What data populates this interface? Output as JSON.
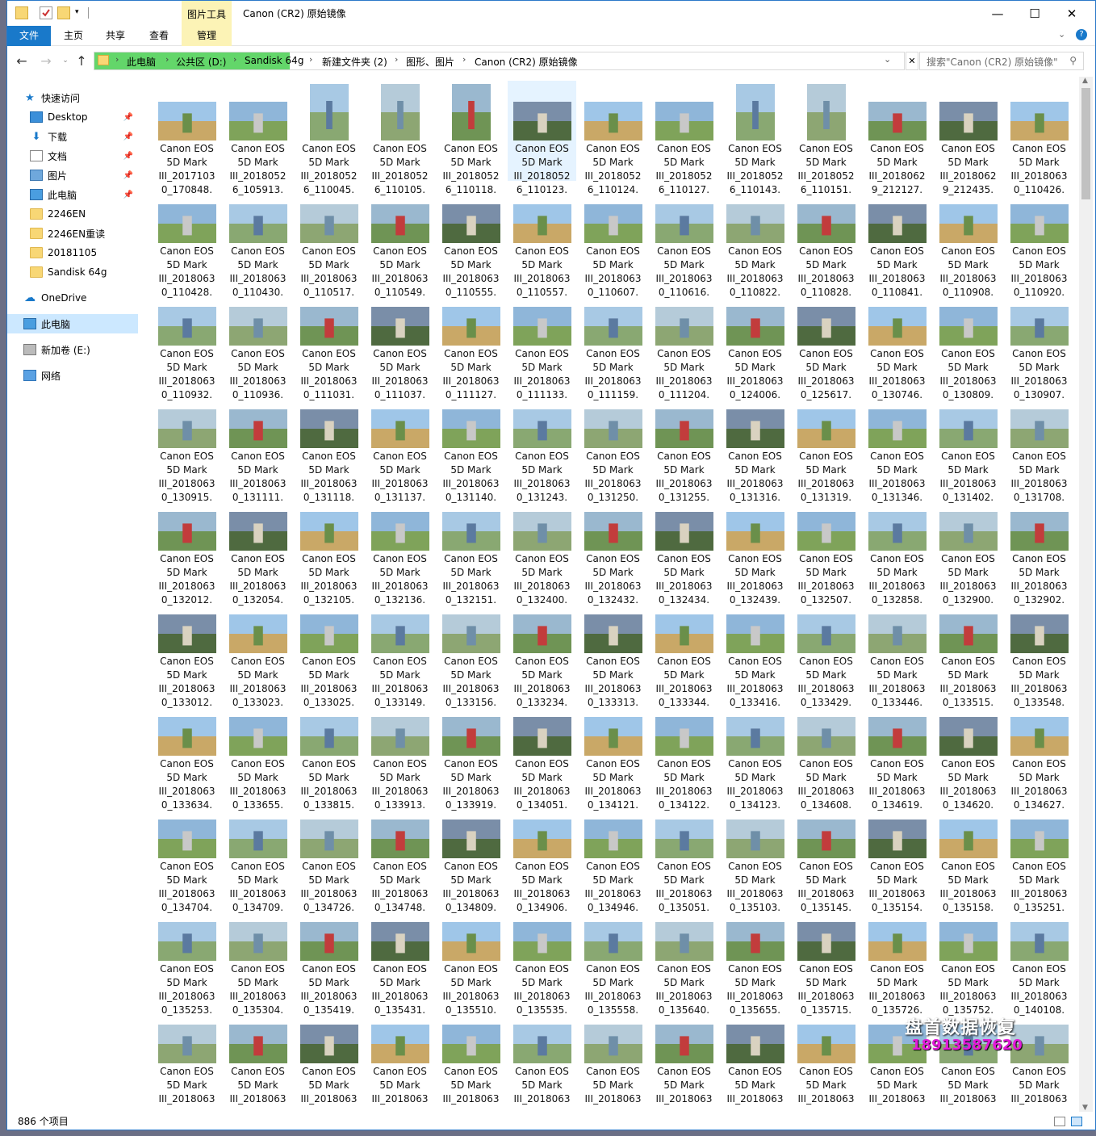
{
  "window": {
    "title": "Canon (CR2) 原始镜像",
    "context_tool": "图片工具",
    "controls": {
      "minimize": "—",
      "maximize": "☐",
      "close": "✕"
    }
  },
  "ribbon": {
    "tabs": [
      {
        "label": "文件",
        "active": true
      },
      {
        "label": "主页"
      },
      {
        "label": "共享"
      },
      {
        "label": "查看"
      },
      {
        "label": "管理"
      }
    ]
  },
  "address": {
    "crumbs": [
      "此电脑",
      "公共区 (D:)",
      "Sandisk 64g",
      "新建文件夹 (2)",
      "图形、图片",
      "Canon (CR2) 原始镜像"
    ],
    "search_placeholder": "搜索\"Canon (CR2) 原始镜像\""
  },
  "nav": {
    "items": [
      {
        "label": "快速访问",
        "icon": "star-icon",
        "pinned": false
      },
      {
        "label": "Desktop",
        "icon": "desktop-icon",
        "pinned": true
      },
      {
        "label": "下载",
        "icon": "download-icon",
        "pinned": true
      },
      {
        "label": "文档",
        "icon": "document-icon",
        "pinned": true
      },
      {
        "label": "图片",
        "icon": "picture-icon",
        "pinned": true
      },
      {
        "label": "此电脑",
        "icon": "computer-icon",
        "pinned": true
      },
      {
        "label": "2246EN",
        "icon": "folder-icon",
        "pinned": false
      },
      {
        "label": "2246EN重读",
        "icon": "folder-icon",
        "pinned": false
      },
      {
        "label": "20181105",
        "icon": "folder-icon",
        "pinned": false
      },
      {
        "label": "Sandisk 64g",
        "icon": "folder-icon",
        "pinned": false
      },
      {
        "label": "OneDrive",
        "icon": "cloud-icon",
        "pinned": false
      },
      {
        "label": "此电脑",
        "icon": "computer-icon",
        "pinned": false,
        "selected": true
      },
      {
        "label": "新加卷 (E:)",
        "icon": "drive-icon",
        "pinned": false
      },
      {
        "label": "网络",
        "icon": "network-icon",
        "pinned": false
      }
    ]
  },
  "files": {
    "line1": "Canon EOS",
    "line2": "5D Mark",
    "rows": [
      [
        "III_2017103|0_170848.",
        "III_2018052|6_105913.",
        "III_2018052|6_110045.",
        "III_2018052|6_110105.",
        "III_2018052|6_110118.",
        "III_2018052|6_110123.",
        "III_2018052|6_110124.",
        "III_2018052|6_110127.",
        "III_2018052|6_110143.",
        "III_2018052|6_110151.",
        "III_2018062|9_212127.",
        "III_2018062|9_212435.",
        "III_2018063|0_110426."
      ],
      [
        "III_2018063|0_110428.",
        "III_2018063|0_110430.",
        "III_2018063|0_110517.",
        "III_2018063|0_110549.",
        "III_2018063|0_110555.",
        "III_2018063|0_110557.",
        "III_2018063|0_110607.",
        "III_2018063|0_110616.",
        "III_2018063|0_110822.",
        "III_2018063|0_110828.",
        "III_2018063|0_110841.",
        "III_2018063|0_110908.",
        "III_2018063|0_110920."
      ],
      [
        "III_2018063|0_110932.",
        "III_2018063|0_110936.",
        "III_2018063|0_111031.",
        "III_2018063|0_111037.",
        "III_2018063|0_111127.",
        "III_2018063|0_111133.",
        "III_2018063|0_111159.",
        "III_2018063|0_111204.",
        "III_2018063|0_124006.",
        "III_2018063|0_125617.",
        "III_2018063|0_130746.",
        "III_2018063|0_130809.",
        "III_2018063|0_130907."
      ],
      [
        "III_2018063|0_130915.",
        "III_2018063|0_131111.",
        "III_2018063|0_131118.",
        "III_2018063|0_131137.",
        "III_2018063|0_131140.",
        "III_2018063|0_131243.",
        "III_2018063|0_131250.",
        "III_2018063|0_131255.",
        "III_2018063|0_131316.",
        "III_2018063|0_131319.",
        "III_2018063|0_131346.",
        "III_2018063|0_131402.",
        "III_2018063|0_131708."
      ],
      [
        "III_2018063|0_132012.",
        "III_2018063|0_132054.",
        "III_2018063|0_132105.",
        "III_2018063|0_132136.",
        "III_2018063|0_132151.",
        "III_2018063|0_132400.",
        "III_2018063|0_132432.",
        "III_2018063|0_132434.",
        "III_2018063|0_132439.",
        "III_2018063|0_132507.",
        "III_2018063|0_132858.",
        "III_2018063|0_132900.",
        "III_2018063|0_132902."
      ],
      [
        "III_2018063|0_133012.",
        "III_2018063|0_133023.",
        "III_2018063|0_133025.",
        "III_2018063|0_133149.",
        "III_2018063|0_133156.",
        "III_2018063|0_133234.",
        "III_2018063|0_133313.",
        "III_2018063|0_133344.",
        "III_2018063|0_133416.",
        "III_2018063|0_133429.",
        "III_2018063|0_133446.",
        "III_2018063|0_133515.",
        "III_2018063|0_133548."
      ],
      [
        "III_2018063|0_133634.",
        "III_2018063|0_133655.",
        "III_2018063|0_133815.",
        "III_2018063|0_133913.",
        "III_2018063|0_133919.",
        "III_2018063|0_134051.",
        "III_2018063|0_134121.",
        "III_2018063|0_134122.",
        "III_2018063|0_134123.",
        "III_2018063|0_134608.",
        "III_2018063|0_134619.",
        "III_2018063|0_134620.",
        "III_2018063|0_134627."
      ],
      [
        "III_2018063|0_134704.",
        "III_2018063|0_134709.",
        "III_2018063|0_134726.",
        "III_2018063|0_134748.",
        "III_2018063|0_134809.",
        "III_2018063|0_134906.",
        "III_2018063|0_134946.",
        "III_2018063|0_135051.",
        "III_2018063|0_135103.",
        "III_2018063|0_135145.",
        "III_2018063|0_135154.",
        "III_2018063|0_135158.",
        "III_2018063|0_135251."
      ],
      [
        "III_2018063|0_135253.",
        "III_2018063|0_135304.",
        "III_2018063|0_135419.",
        "III_2018063|0_135431.",
        "III_2018063|0_135510.",
        "III_2018063|0_135535.",
        "III_2018063|0_135558.",
        "III_2018063|0_135640.",
        "III_2018063|0_135655.",
        "III_2018063|0_135715.",
        "III_2018063|0_135726.",
        "III_2018063|0_135752.",
        "III_2018063|0_140108."
      ],
      [
        "III_2018063|",
        "III_2018063|",
        "III_2018063|",
        "III_2018063|",
        "III_2018063|",
        "III_2018063|",
        "III_2018063|",
        "III_2018063|",
        "III_2018063|",
        "III_2018063|",
        "III_2018063|",
        "III_2018063|",
        "III_2018063|"
      ]
    ],
    "selected": [
      0,
      5
    ]
  },
  "status": {
    "count": "886 个项目"
  },
  "watermark": {
    "line1": "盘首数据恢复",
    "line2": "18913587620"
  },
  "colors": {
    "accent": "#1979ca",
    "context": "#fcf3b6",
    "selection": "#e5f3ff",
    "address_highlight": "#63d66a"
  }
}
